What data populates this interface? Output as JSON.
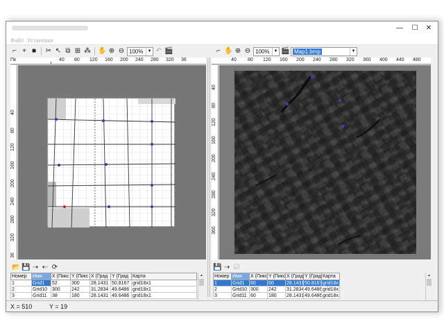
{
  "window": {
    "minimize_glyph": "—",
    "maximize_glyph": "☐",
    "close_glyph": "✕"
  },
  "menu": {
    "items": [
      "Файл",
      "Установки"
    ]
  },
  "left_panel": {
    "zoom_value": "100%",
    "ruler_corner_label": "Пк",
    "ruler_h_ticks": [
      "40",
      "80",
      "120",
      "160",
      "200",
      "240",
      "280",
      "320",
      "36"
    ],
    "ruler_v_ticks": [
      "40",
      "80",
      "120",
      "160",
      "200",
      "240",
      "280",
      "320",
      "36"
    ],
    "table": {
      "headers": [
        "Номер",
        "Имя",
        "X (Пикс",
        "Y (Пикс",
        "X (Град",
        "Y (Град",
        "Карта"
      ],
      "rows": [
        [
          "1",
          "Grid1",
          "52",
          "300",
          "28.1431",
          "50.8167",
          "grid18x1"
        ],
        [
          "2",
          "Grid10",
          "300",
          "242",
          "31.2834",
          "49.6486",
          "grid18x1"
        ],
        [
          "3",
          "Grid11",
          "38",
          "180",
          "28.1431",
          "49.6486",
          "grid18x1"
        ]
      ]
    }
  },
  "right_panel": {
    "zoom_value": "100%",
    "map_file": "Map1.bmp",
    "ruler_h_ticks": [
      "40",
      "80",
      "120",
      "160",
      "200",
      "240",
      "280",
      "320",
      "360",
      "400",
      "440",
      "480"
    ],
    "ruler_v_ticks": [
      "40",
      "80",
      "120",
      "160",
      "200",
      "240",
      "280",
      "320",
      "360"
    ],
    "table": {
      "headers": [
        "Номер",
        "Имя",
        "X (Пикс",
        "Y (Пикс",
        "X (Град",
        "Y (Град",
        "Карта"
      ],
      "rows": [
        [
          "1",
          "Grid1",
          "60",
          "60",
          "28.1431",
          "50.8167",
          "grid18x"
        ],
        [
          "2",
          "Grid10",
          "300",
          "242",
          "31.2834",
          "49.6486",
          "grid18x1"
        ],
        [
          "3",
          "Grid11",
          "60",
          "180",
          "28.1431",
          "49.6486",
          "grid18x1"
        ]
      ]
    }
  },
  "status": {
    "x_text": "X = 510",
    "y_text": "Y = 19"
  }
}
